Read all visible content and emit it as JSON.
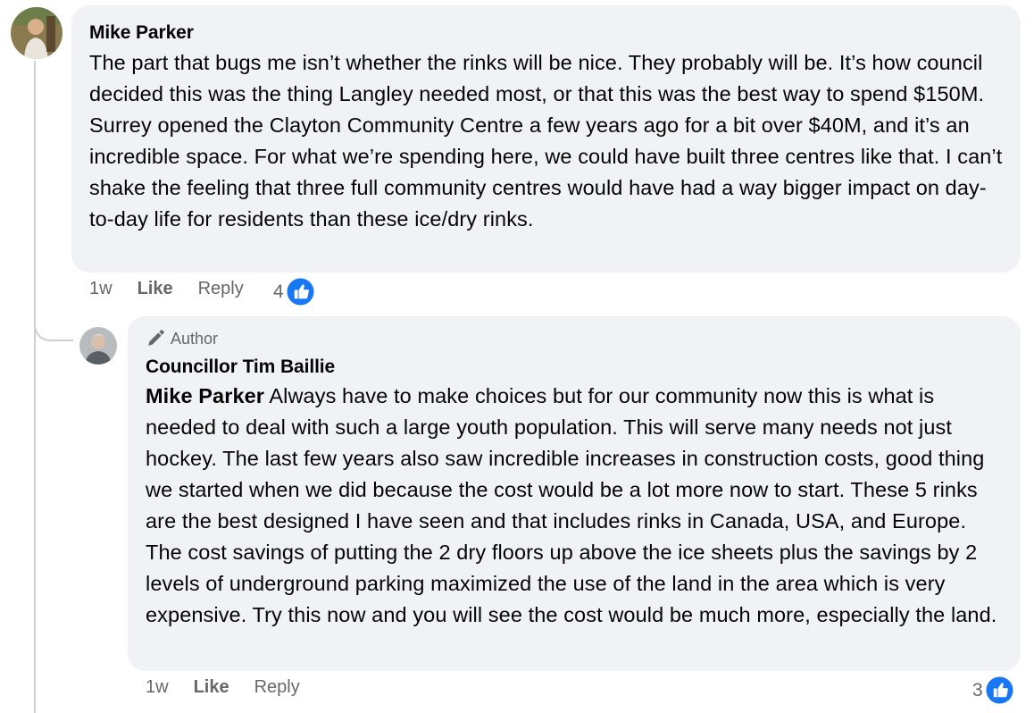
{
  "comment": {
    "author": "Mike Parker",
    "text": "The part that bugs me isn’t whether the rinks will be nice. They probably will be. It’s how council decided this was the thing Langley needed most, or that this was the best way to spend $150M. Surrey opened the Clayton Community Centre a few years ago for a bit over $40M, and it’s an incredible space. For what we’re spending here, we could have built three centres like that. I can’t shake the feeling that three full community centres would have had a way bigger impact on day-to-day life for residents than these ice/dry rinks.",
    "time": "1w",
    "like_label": "Like",
    "reply_label": "Reply",
    "reaction_count": "4",
    "reaction_icon": "like-icon"
  },
  "reply": {
    "badge_icon": "pencil-icon",
    "badge_label": "Author",
    "author": "Councillor Tim Baillie",
    "mention": "Mike Parker",
    "text": " Always have to make choices but for our community now this is what is needed to deal with such a large youth population. This will serve many needs not just hockey. The last few years also saw incredible increases in construction costs, good thing we started when we did because the cost would be a lot more now to start. These 5 rinks are the best designed I have seen and that includes rinks in Canada, USA, and Europe. The cost savings of putting the 2 dry floors up above the ice sheets plus the savings by 2 levels of underground parking maximized the use of the land in the area which is very expensive. Try this now and you will see the cost would be much more, especially the land.",
    "time": "1w",
    "like_label": "Like",
    "reply_label": "Reply",
    "reaction_count": "3",
    "reaction_icon": "like-icon"
  },
  "colors": {
    "bubble": "#f0f2f5",
    "secondary_text": "#65676b",
    "like_blue": "#1877f2",
    "thread_line": "#ced0d4"
  }
}
